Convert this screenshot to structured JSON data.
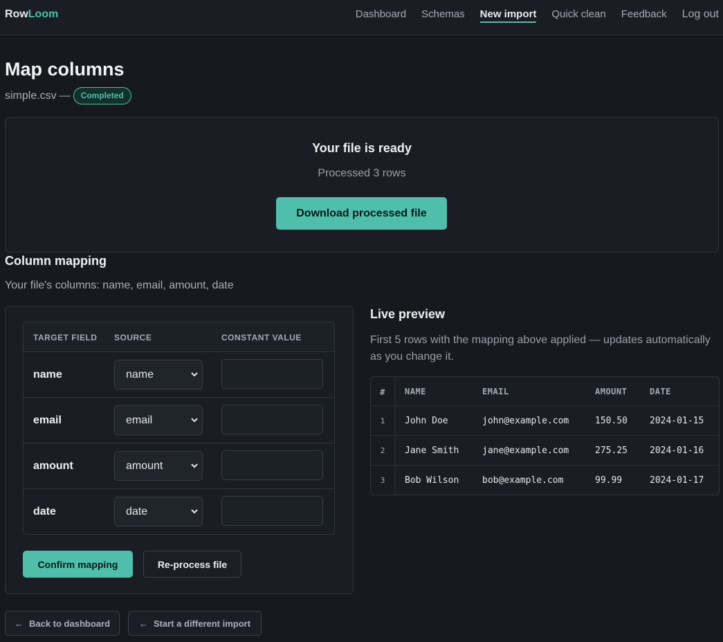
{
  "brand": {
    "part1": "Row",
    "part2": "Loom",
    "accent": "#4fbfab"
  },
  "nav": {
    "dashboard": "Dashboard",
    "schemas": "Schemas",
    "new_import": "New import",
    "quick_clean": "Quick clean",
    "feedback": "Feedback",
    "logout": "Log out",
    "active": "New import"
  },
  "page": {
    "title": "Map columns",
    "filename": "simple.csv",
    "dash": "—",
    "status": "Completed"
  },
  "ready": {
    "title": "Your file is ready",
    "subtitle": "Processed 3 rows",
    "download_label": "Download processed file"
  },
  "mapping": {
    "title": "Column mapping",
    "subtitle": "Your file's columns: name, email, amount, date",
    "headers": {
      "target": "TARGET FIELD",
      "source": "SOURCE",
      "constant": "CONSTANT VALUE"
    },
    "rows": [
      {
        "field": "name",
        "source": "name",
        "constant": ""
      },
      {
        "field": "email",
        "source": "email",
        "constant": ""
      },
      {
        "field": "amount",
        "source": "amount",
        "constant": ""
      },
      {
        "field": "date",
        "source": "date",
        "constant": ""
      }
    ],
    "confirm_label": "Confirm mapping",
    "reprocess_label": "Re-process file"
  },
  "preview": {
    "title": "Live preview",
    "description": "First 5 rows with the mapping above applied — updates automatically as you change it.",
    "headers": {
      "num": "#",
      "name": "NAME",
      "email": "EMAIL",
      "amount": "AMOUNT",
      "date": "DATE"
    },
    "rows": [
      {
        "num": "1",
        "name": "John Doe",
        "email": "john@example.com",
        "amount": "150.50",
        "date": "2024-01-15"
      },
      {
        "num": "2",
        "name": "Jane Smith",
        "email": "jane@example.com",
        "amount": "275.25",
        "date": "2024-01-16"
      },
      {
        "num": "3",
        "name": "Bob Wilson",
        "email": "bob@example.com",
        "amount": "99.99",
        "date": "2024-01-17"
      }
    ]
  },
  "footer": {
    "arrow": "←",
    "back_label": "Back to dashboard",
    "different_label": "Start a different import"
  }
}
